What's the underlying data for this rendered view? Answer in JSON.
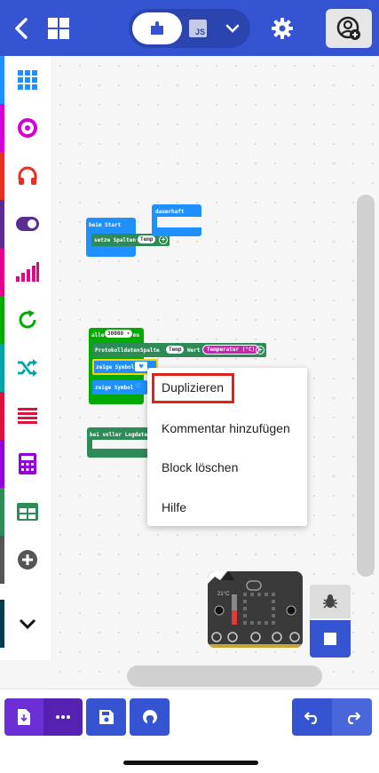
{
  "header": {
    "back_icon": "chevron-left-icon",
    "home_icon": "grid-icon",
    "toggle": {
      "blocks_icon": "puzzle-icon",
      "js_label": "JS",
      "dropdown_icon": "chevron-down-icon"
    },
    "settings_icon": "gear-icon",
    "account_icon": "account-add-icon",
    "colors": {
      "bar": "#3454d1"
    }
  },
  "toolbox": {
    "categories": [
      {
        "icon": "grid-icon",
        "color": "#1e90ff"
      },
      {
        "icon": "circle-icon",
        "color": "#d400d4"
      },
      {
        "icon": "headphones-icon",
        "color": "#e63022"
      },
      {
        "icon": "toggle-icon",
        "color": "#5c2d91"
      },
      {
        "icon": "signal-icon",
        "color": "#e3008c"
      },
      {
        "icon": "loop-icon",
        "color": "#00aa00"
      },
      {
        "icon": "shuffle-icon",
        "color": "#00a4a6"
      },
      {
        "icon": "list-icon",
        "color": "#dc143c"
      },
      {
        "icon": "calculator-icon",
        "color": "#9400d3"
      },
      {
        "icon": "table-icon",
        "color": "#2e8b57"
      },
      {
        "icon": "plus-circle-icon",
        "color": "#555555"
      },
      {
        "icon": "chevron-down-icon",
        "color": "#003a4d"
      }
    ]
  },
  "blocks": {
    "on_start": {
      "label": "beim Start",
      "set_columns": "setze Spalten",
      "temp_pill": "Temp"
    },
    "forever": {
      "label": "dauerhaft"
    },
    "every": {
      "label": "alle",
      "ms_value": "30000",
      "ms_unit": "ms"
    },
    "log_data": {
      "label": "Protokolldaten",
      "column": "Spalte",
      "temp_pill": "Temp",
      "value": "Wert",
      "sensor": "Temperatur (°C)"
    },
    "show_icon_1": {
      "label": "zeige Symbol"
    },
    "show_icon_2": {
      "label": "zeige Symbol"
    },
    "log_full": {
      "label": "bei voller Logdatei"
    }
  },
  "context_menu": {
    "items": [
      "Duplizieren",
      "Kommentar hinzufügen",
      "Block löschen",
      "Hilfe"
    ]
  },
  "simulator": {
    "temp_readout": "21°C",
    "debug_icon": "bug-icon",
    "stop_icon": "stop-icon"
  },
  "bottom_bar": {
    "download_icon": "download-icon",
    "more_icon": "ellipsis-icon",
    "save_icon": "save-icon",
    "github_icon": "github-icon",
    "undo_icon": "undo-icon",
    "redo_icon": "redo-icon",
    "colors": {
      "download": "#6c2fd6",
      "blue": "#3454d1"
    }
  }
}
